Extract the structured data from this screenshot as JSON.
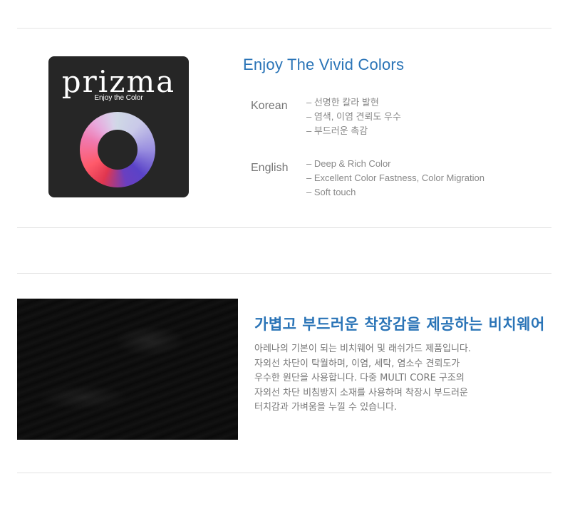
{
  "logo": {
    "word": "prizma",
    "tagline": "Enjoy the Color"
  },
  "intro": {
    "heading": "Enjoy The Vivid Colors",
    "korean_label": "Korean",
    "korean_lines": [
      "– 선명한 칼라 발현",
      "– 염색, 이염 견뢰도 우수",
      "– 부드러운 촉감"
    ],
    "english_label": "English",
    "english_lines": [
      "– Deep & Rich Color",
      "– Excellent Color Fastness, Color Migration",
      "– Soft touch"
    ]
  },
  "fabric_section": {
    "heading": "가볍고 부드러운 착장감을 제공하는 비치웨어",
    "paragraph_lines": [
      "아레나의 기본이 되는 비치웨어 및 래쉬가드 제품입니다.",
      "자외선 차단이 탁월하며, 이염, 세탁, 염소수 견뢰도가",
      "우수한 원단을 사용합니다. 다중 MULTI CORE 구조의",
      "자외선 차단 비침방지 소재를 사용하며 착장시 부드러운",
      "터치감과 가벼움을 누낄 수 있습니다."
    ]
  },
  "colors": {
    "heading": "#2a74b7",
    "logo_bg": "#262626",
    "rule": "#e3e3e3"
  }
}
